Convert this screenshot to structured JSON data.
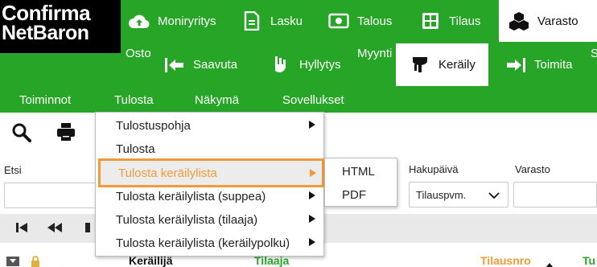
{
  "logo": {
    "line1": "Confirma",
    "line2": "NetBaron"
  },
  "top_nav": [
    {
      "label": "Moniryritys",
      "icon": "cloud-upload-icon"
    },
    {
      "label": "Lasku",
      "icon": "document-icon"
    },
    {
      "label": "Talous",
      "icon": "money-icon"
    },
    {
      "label": "Tilaus",
      "icon": "grid-icon"
    },
    {
      "label": "Varasto",
      "icon": "boxes-icon",
      "active": true
    }
  ],
  "sub_nav": {
    "osto_label": "Osto",
    "myynti_label": "Myynti",
    "s_label": "S",
    "items": [
      {
        "label": "Saavuta",
        "icon": "receive-arrows-icon"
      },
      {
        "label": "Hyllytys",
        "icon": "hand-shelving-icon"
      },
      {
        "label": "Keräily",
        "icon": "picking-icon",
        "active": true
      },
      {
        "label": "Toimita",
        "icon": "deliver-icon"
      }
    ]
  },
  "menubar": {
    "items": [
      "Toiminnot",
      "Tulosta",
      "Näkymä",
      "Sovellukset"
    ]
  },
  "toolbar": {
    "search_icon": "search-icon",
    "print_icon": "printer-icon"
  },
  "filters": {
    "etsi_label": "Etsi",
    "etsi_value": "",
    "hakupaiva_label": "Hakupäivä",
    "hakupaiva_value": "Tilauspvm.",
    "varasto_label": "Varasto",
    "varasto_value": ""
  },
  "grid": {
    "headers": {
      "kerailija": "Keräilijä",
      "tilaaja": "Tilaaja",
      "tilausnro": "Tilausnro",
      "tu": "Tu"
    }
  },
  "print_menu": {
    "items": [
      {
        "label": "Tulostuspohja",
        "submenu": true
      },
      {
        "label": "Tulosta",
        "submenu": false
      },
      {
        "label": "Tulosta keräilylista",
        "submenu": true,
        "highlighted": true
      },
      {
        "label": "Tulosta keräilylista (suppea)",
        "submenu": true
      },
      {
        "label": "Tulosta keräilylista (tilaaja)",
        "submenu": true
      },
      {
        "label": "Tulosta keräilylista (keräilypolku)",
        "submenu": true
      }
    ],
    "submenu_items": [
      "HTML",
      "PDF"
    ]
  },
  "colors": {
    "brand_green": "#26a526",
    "highlight_orange": "#f29a38",
    "header_black": "#000000"
  }
}
